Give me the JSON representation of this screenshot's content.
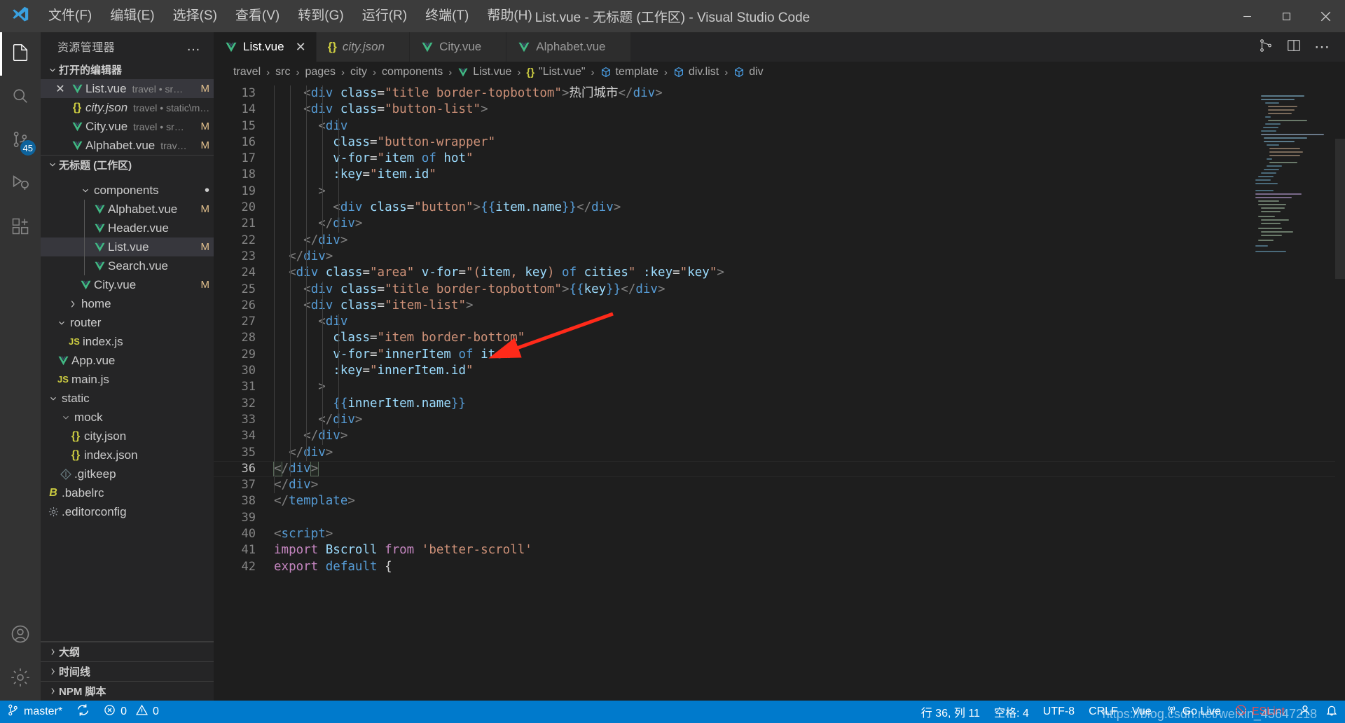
{
  "window": {
    "title": "List.vue - 无标题 (工作区) - Visual Studio Code",
    "minimize": "—",
    "maximize": "□",
    "close": "✕"
  },
  "menu": [
    {
      "label": "文件(F)"
    },
    {
      "label": "编辑(E)"
    },
    {
      "label": "选择(S)"
    },
    {
      "label": "查看(V)"
    },
    {
      "label": "转到(G)"
    },
    {
      "label": "运行(R)"
    },
    {
      "label": "终端(T)"
    },
    {
      "label": "帮助(H)"
    }
  ],
  "activitybar": {
    "items": [
      {
        "name": "explorer",
        "icon": "files-icon"
      },
      {
        "name": "search",
        "icon": "search-icon"
      },
      {
        "name": "source-control",
        "icon": "source-control-icon",
        "badge": "45"
      },
      {
        "name": "run-debug",
        "icon": "run-debug-icon"
      },
      {
        "name": "extensions",
        "icon": "extensions-icon"
      },
      {
        "name": "accounts",
        "icon": "account-icon"
      },
      {
        "name": "settings",
        "icon": "gear-icon"
      }
    ]
  },
  "sidebar": {
    "title": "资源管理器",
    "more": "…",
    "open_editors": {
      "label": "打开的编辑器",
      "items": [
        {
          "name": "List.vue",
          "desc": "travel • sr…",
          "badge": "M",
          "icon": "vue-icon",
          "selected": true,
          "close": "✕"
        },
        {
          "name": "city.json",
          "desc": "travel • static\\m…",
          "badge": "",
          "icon": "json-icon",
          "italic": true
        },
        {
          "name": "City.vue",
          "desc": "travel • sr…",
          "badge": "M",
          "icon": "vue-icon"
        },
        {
          "name": "Alphabet.vue",
          "desc": "trav… ",
          "badge": "M",
          "icon": "vue-icon"
        }
      ]
    },
    "workspace": {
      "label": "无标题 (工作区)",
      "items": [
        {
          "name": "components",
          "icon": "folder-open-icon",
          "indent": 3,
          "expanded": true,
          "dot": true
        },
        {
          "name": "Alphabet.vue",
          "icon": "vue-icon",
          "indent": 4,
          "badge": "M"
        },
        {
          "name": "Header.vue",
          "icon": "vue-icon",
          "indent": 4
        },
        {
          "name": "List.vue",
          "icon": "vue-icon",
          "indent": 4,
          "badge": "M",
          "selected": true
        },
        {
          "name": "Search.vue",
          "icon": "vue-icon",
          "indent": 4
        },
        {
          "name": "City.vue",
          "icon": "vue-icon",
          "indent": 3,
          "badge": "M"
        },
        {
          "name": "home",
          "icon": "folder-icon",
          "indent": 2,
          "expanded": false
        },
        {
          "name": "router",
          "icon": "folder-open-icon",
          "indent": 2,
          "expanded": true
        },
        {
          "name": "index.js",
          "icon": "js-icon",
          "indent": 3
        },
        {
          "name": "App.vue",
          "icon": "vue-icon",
          "indent": 2
        },
        {
          "name": "main.js",
          "icon": "js-icon",
          "indent": 2
        },
        {
          "name": "static",
          "icon": "folder-open-icon",
          "indent": 1,
          "expanded": true
        },
        {
          "name": "mock",
          "icon": "folder-open-icon",
          "indent": 2,
          "expanded": true
        },
        {
          "name": "city.json",
          "icon": "json-icon",
          "indent": 3
        },
        {
          "name": "index.json",
          "icon": "json-icon",
          "indent": 3
        },
        {
          "name": ".gitkeep",
          "icon": "git-icon",
          "indent": 2
        },
        {
          "name": ".babelrc",
          "icon": "babel-icon",
          "indent": 1
        },
        {
          "name": ".editorconfig",
          "icon": "config-icon",
          "indent": 1
        }
      ]
    },
    "bottom_sections": [
      {
        "label": "大纲"
      },
      {
        "label": "时间线"
      },
      {
        "label": "NPM 脚本"
      }
    ]
  },
  "tabs": [
    {
      "label": "List.vue",
      "icon": "vue-icon",
      "active": true,
      "close": "✕"
    },
    {
      "label": "city.json",
      "icon": "json-icon",
      "active": false,
      "italic": true
    },
    {
      "label": "City.vue",
      "icon": "vue-icon",
      "active": false
    },
    {
      "label": "Alphabet.vue",
      "icon": "vue-icon",
      "active": false
    }
  ],
  "tab_actions": [
    {
      "name": "split-editor-compare-icon"
    },
    {
      "name": "split-editor-icon"
    },
    {
      "name": "more-actions-icon"
    }
  ],
  "breadcrumb": [
    {
      "label": "travel",
      "icon": ""
    },
    {
      "label": "src",
      "icon": ""
    },
    {
      "label": "pages",
      "icon": ""
    },
    {
      "label": "city",
      "icon": ""
    },
    {
      "label": "components",
      "icon": ""
    },
    {
      "label": "List.vue",
      "icon": "vue-icon"
    },
    {
      "label": "\"List.vue\"",
      "icon": "json-icon"
    },
    {
      "label": "template",
      "icon": "symbol-icon"
    },
    {
      "label": "div.list",
      "icon": "symbol-icon"
    },
    {
      "label": "div",
      "icon": "symbol-icon"
    }
  ],
  "editor": {
    "first_line": 13,
    "current_line": 36,
    "lines": [
      {
        "n": 13,
        "text": "    <div class=\"title border-topbottom\">热门城市</div>"
      },
      {
        "n": 14,
        "text": "    <div class=\"button-list\">"
      },
      {
        "n": 15,
        "text": "      <div"
      },
      {
        "n": 16,
        "text": "        class=\"button-wrapper\""
      },
      {
        "n": 17,
        "text": "        v-for=\"item of hot\""
      },
      {
        "n": 18,
        "text": "        :key=\"item.id\""
      },
      {
        "n": 19,
        "text": "      >"
      },
      {
        "n": 20,
        "text": "        <div class=\"button\">{{item.name}}</div>"
      },
      {
        "n": 21,
        "text": "      </div>"
      },
      {
        "n": 22,
        "text": "    </div>"
      },
      {
        "n": 23,
        "text": "  </div>"
      },
      {
        "n": 24,
        "text": "  <div class=\"area\" v-for=\"(item, key) of cities\" :key=\"key\">"
      },
      {
        "n": 25,
        "text": "    <div class=\"title border-topbottom\">{{key}}</div>"
      },
      {
        "n": 26,
        "text": "    <div class=\"item-list\">"
      },
      {
        "n": 27,
        "text": "      <div"
      },
      {
        "n": 28,
        "text": "        class=\"item border-bottom\""
      },
      {
        "n": 29,
        "text": "        v-for=\"innerItem of item\""
      },
      {
        "n": 30,
        "text": "        :key=\"innerItem.id\""
      },
      {
        "n": 31,
        "text": "      >"
      },
      {
        "n": 32,
        "text": "        {{innerItem.name}}"
      },
      {
        "n": 33,
        "text": "      </div>"
      },
      {
        "n": 34,
        "text": "    </div>"
      },
      {
        "n": 35,
        "text": "  </div>"
      },
      {
        "n": 36,
        "text": "</div>"
      },
      {
        "n": 37,
        "text": "</div>"
      },
      {
        "n": 38,
        "text": "</template>"
      },
      {
        "n": 39,
        "text": ""
      },
      {
        "n": 40,
        "text": "<script>"
      },
      {
        "n": 41,
        "text": "import Bscroll from 'better-scroll'"
      },
      {
        "n": 42,
        "text": "export default {"
      }
    ]
  },
  "statusbar": {
    "branch": "master*",
    "sync_icon": "sync-icon",
    "errors": "0",
    "warnings": "0",
    "cursor": "行 36, 列 11",
    "spaces": "空格: 4",
    "encoding": "UTF-8",
    "eol": "CRLF",
    "language": "Vue",
    "golive": "Go Live",
    "eslint": "ESLint",
    "bell_icon": "bell-icon",
    "person_icon": "person-icon",
    "watermark": "https://blog.csdn.net/weixin_45647218"
  },
  "colors": {
    "accent": "#007acc",
    "titlebar": "#3c3c3c",
    "sidebar": "#252526",
    "editor": "#1e1e1e",
    "activitybar": "#333333",
    "vue_green": "#41b883",
    "json_yellow": "#cbcb41",
    "modified": "#e2c08d",
    "arrow_red": "#ff2a1a"
  }
}
